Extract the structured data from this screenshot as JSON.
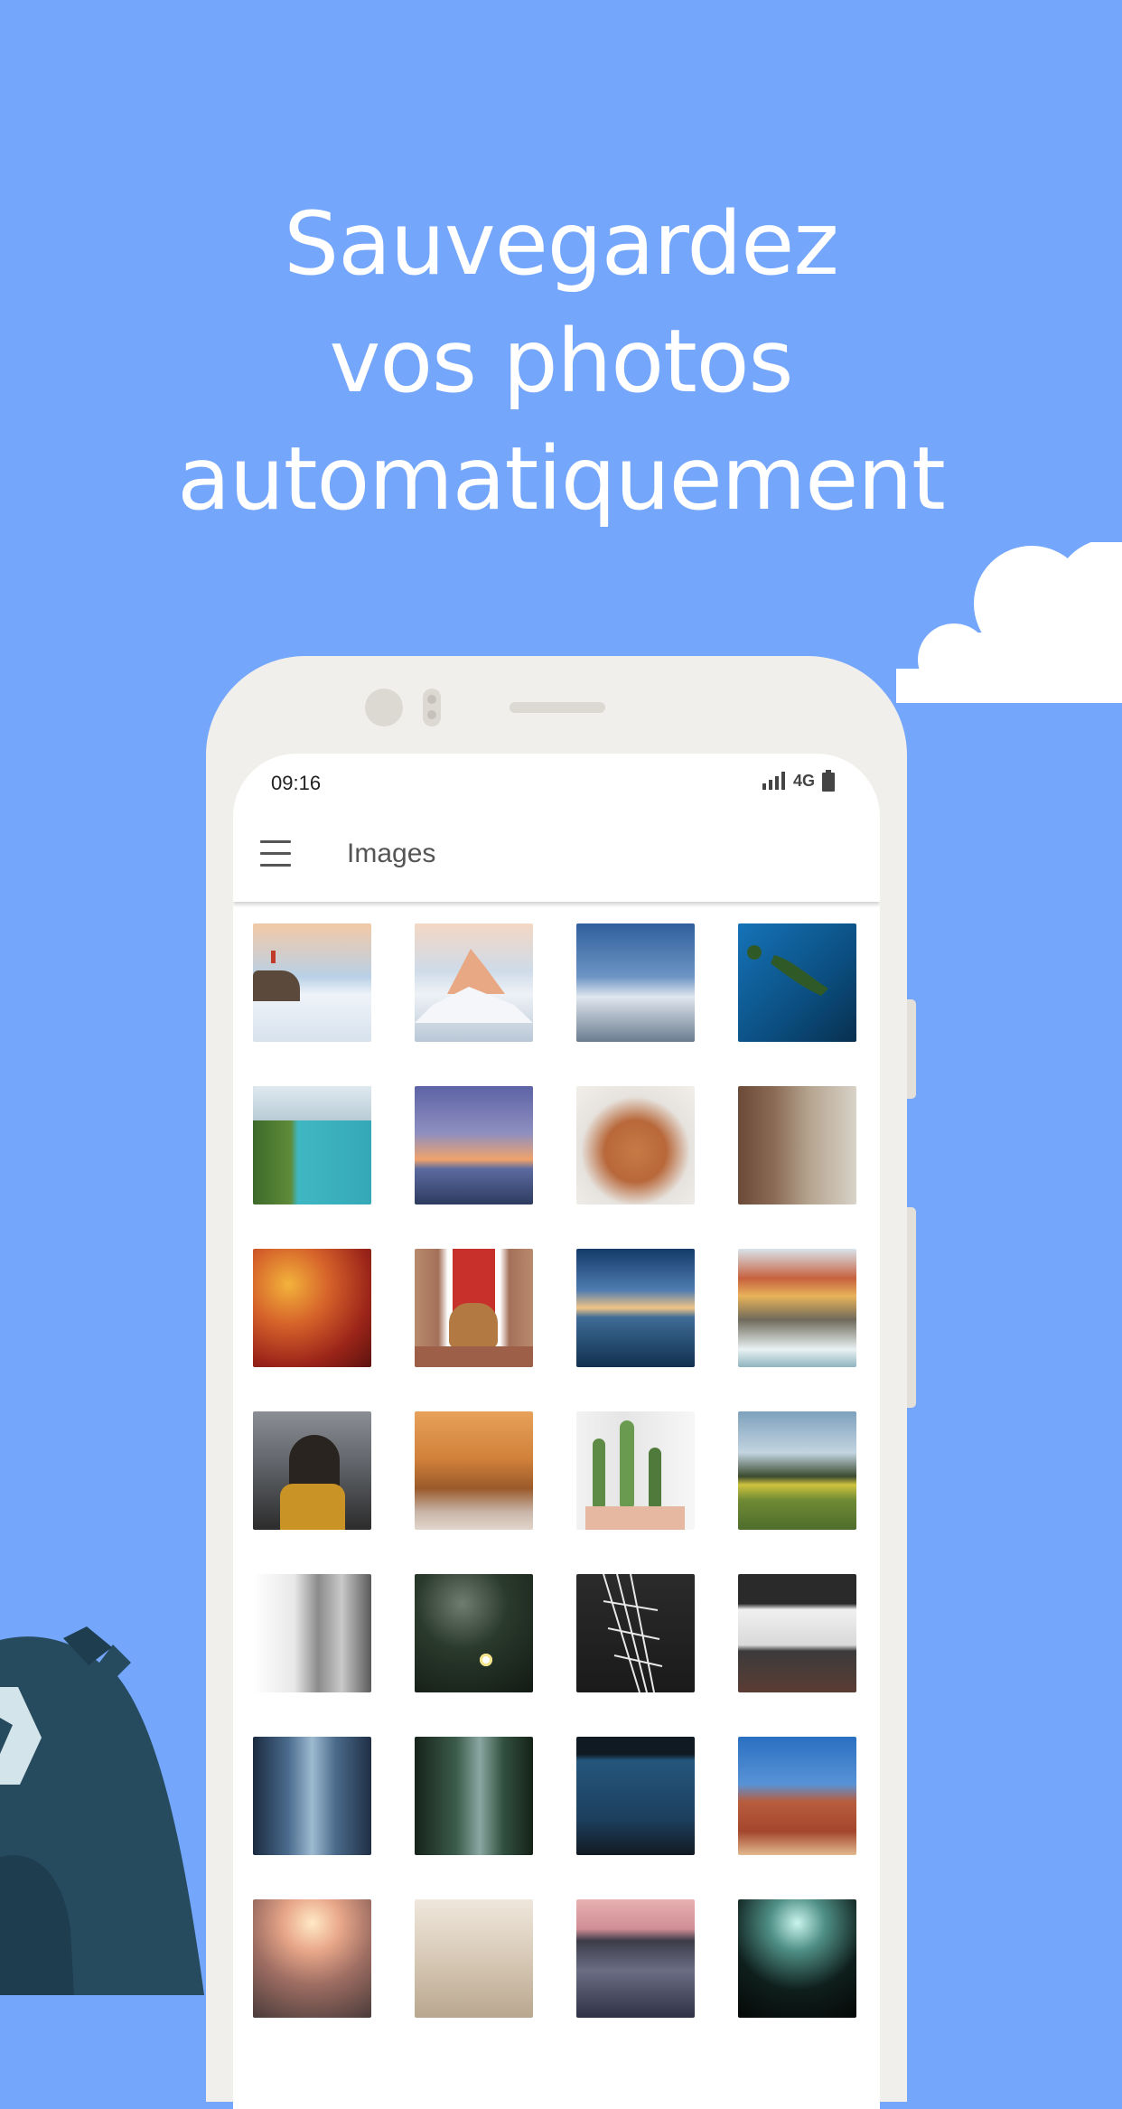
{
  "headline": {
    "line1": "Sauvegardez",
    "line2": "vos photos",
    "line3": "automatiquement"
  },
  "colors": {
    "background": "#74a6fc",
    "phone_body": "#f1efeb",
    "cloud": "#ffffff",
    "mascot": "#274b5e"
  },
  "phone": {
    "status_bar": {
      "time": "09:16",
      "network": "4G"
    },
    "app_bar": {
      "menu_icon": "hamburger-menu-icon",
      "title": "Images"
    }
  },
  "photos": [
    "Hiker on rock, snowy peak",
    "Matterhorn at dawn",
    "Snowy mountain range",
    "Island in blue lake",
    "Turquoise fjord",
    "Lake at sunset",
    "Fluffy dog",
    "Friends with totem",
    "Autumn leaves",
    "Dog at red door",
    "Mountain reflection",
    "Cliffside village",
    "Child at window",
    "Autumn avenue",
    "Cacti in pots",
    "Green field",
    "Old building",
    "Daisy in dark",
    "Tower structure",
    "Modern architecture",
    "City street",
    "Forest walk",
    "ATM booth",
    "Red rock",
    "Sunset portrait",
    "Linen and tools",
    "Pink lake",
    "Dark tunnel"
  ]
}
